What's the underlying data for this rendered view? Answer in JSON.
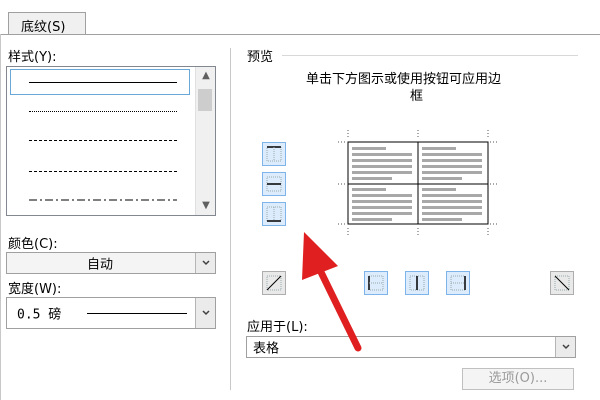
{
  "tab": {
    "label": "底纹(S)"
  },
  "style": {
    "label": "样式(Y):",
    "items": [
      "solid",
      "dotted",
      "dashed-small",
      "dashed",
      "dash-dot"
    ]
  },
  "color": {
    "label": "颜色(C):",
    "value": "自动"
  },
  "width": {
    "label": "宽度(W):",
    "value": "0.5 磅"
  },
  "preview": {
    "title": "预览",
    "instruction_line1": "单击下方图示或使用按钮可应用边",
    "instruction_line2": "框"
  },
  "apply_to": {
    "label": "应用于(L):",
    "value": "表格"
  },
  "options_button": {
    "label": "选项(O)..."
  },
  "colors": {
    "accent_button_bg": "#dcecfc",
    "accent_button_border": "#7eb4ea",
    "arrow": "#e02020"
  },
  "icons": {
    "border_buttons_left": [
      "top-border-icon",
      "inside-horizontal-border-icon",
      "bottom-border-icon"
    ],
    "border_buttons_bottom": [
      "diagonal-up-border-icon",
      "left-border-icon",
      "inside-vertical-border-icon",
      "right-border-icon",
      "diagonal-down-border-icon"
    ]
  }
}
